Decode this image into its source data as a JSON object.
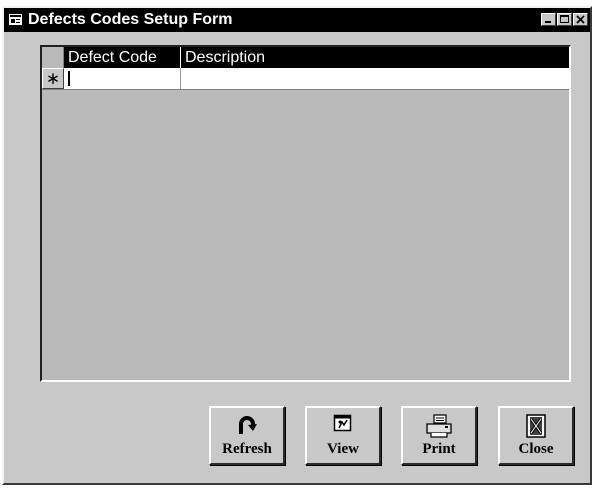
{
  "window": {
    "title": "Defects Codes Setup Form"
  },
  "grid": {
    "columns": [
      "Defect Code",
      "Description"
    ],
    "new_row_marker": "∗",
    "rows": []
  },
  "buttons": {
    "refresh": "Refresh",
    "view": "View",
    "print": "Print",
    "close": "Close"
  }
}
